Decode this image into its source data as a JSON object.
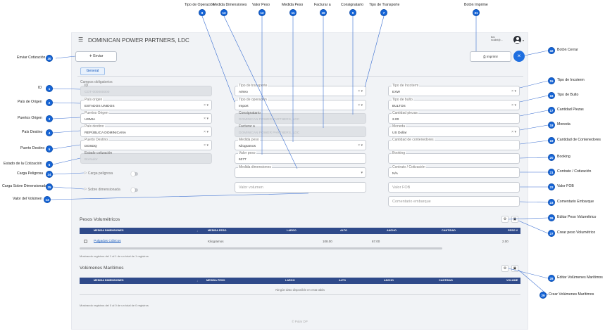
{
  "header": {
    "title": "DOMINICAN POWER PARTNERS, LDC",
    "user_name": "Bev",
    "user_email": "ecollet@..."
  },
  "toolbar": {
    "send_label": "Enviar",
    "print_label": "Imprimir"
  },
  "tabs": {
    "general": "General"
  },
  "form": {
    "required_note": "Campos obligatorios",
    "id": {
      "label": "ID",
      "value": "COT-000000000"
    },
    "pais_origen": {
      "label": "País origen",
      "value": "ESTADOS UNIDOS"
    },
    "puertos_origen": {
      "label": "Puertos Origen",
      "value": "USMIA"
    },
    "pais_destino": {
      "label": "País destino",
      "value": "REPÚBLICA DOMINICANA"
    },
    "puerto_destino": {
      "label": "Puerto Destino",
      "value": "DOSDQ"
    },
    "estado": {
      "label": "Estado cotización",
      "value": "Borrador"
    },
    "carga_peligrosa": {
      "label": "Carga peligrosa"
    },
    "sobre_dimensionada": {
      "label": "Sobre dimensionada"
    },
    "tipo_transporte": {
      "label": "Tipo de transporte",
      "value": "Aéreo"
    },
    "tipo_operacion": {
      "label": "Tipo de operación",
      "value": "Import"
    },
    "consignatario": {
      "label": "Consignatario",
      "value": "DOMINICAN POWER PARTNERS, LDC"
    },
    "facturar_a": {
      "label": "Facturar a",
      "value": "DOMINICAN POWER PARTNERS, LDC"
    },
    "medida_peso": {
      "label": "Medida peso",
      "value": "Kilogramos"
    },
    "valor_peso": {
      "label": "Valor peso",
      "value": "6277"
    },
    "medida_dimensiones": {
      "label": "Medida dimensiones"
    },
    "valor_volumen": {
      "placeholder": "Valor volumen"
    },
    "tipo_incoterm": {
      "label": "Tipo de Incoterm",
      "value": "EXW"
    },
    "tipo_bulto": {
      "label": "Tipo de bulto",
      "value": "BULTOS"
    },
    "cantidad_piezas": {
      "label": "Cantidad piezas",
      "value": "2.00"
    },
    "moneda": {
      "label": "Moneda",
      "value": "US Dollar"
    },
    "cantidad_contenedores": {
      "placeholder": "Cantidad de contenedores"
    },
    "booking": {
      "placeholder": "Booking"
    },
    "contrato": {
      "label": "Contrato / Cotización",
      "value": "N/A"
    },
    "valor_fob": {
      "placeholder": "Valor FOB"
    },
    "comentario": {
      "placeholder": "Comentario embarque"
    }
  },
  "pesos": {
    "title": "Pesos Volumétricos",
    "columns": [
      "MEDIDA DIMENSIONES",
      "MEDIDA PESO",
      "LARGO",
      "ALTO",
      "ANCHO",
      "CANTIDAD",
      "PESO V"
    ],
    "row": {
      "medida_dimensiones": "Pulgadas Cúbicos",
      "medida_peso": "Kilogramos",
      "largo": "108.00",
      "alto": "67.00",
      "ancho": "",
      "cantidad": "2.00"
    },
    "footer": "Mostrando registros del 1 al 1 de un total de 1 registros"
  },
  "volumenes": {
    "title": "Volúmenes Marítimos",
    "columns": [
      "MEDIDA DIMENSIONES",
      "MEDIDA PESO",
      "LARGO",
      "ALTO",
      "ANCHO",
      "CANTIDAD",
      "VOLUME"
    ],
    "empty": "Ningún dato disponible en esta tabla",
    "footer": "Mostrando registros del 0 al 0 de un total de 0 registros"
  },
  "footer": {
    "copyright": "© Polar DP"
  },
  "callouts": [
    {
      "n": "1",
      "text": "ID"
    },
    {
      "n": "2",
      "text": "País de Origen"
    },
    {
      "n": "3",
      "text": "Puertos Origen"
    },
    {
      "n": "4",
      "text": "País Destino"
    },
    {
      "n": "5",
      "text": "Puerto Destino"
    },
    {
      "n": "6",
      "text": "Estado de la Cotización"
    },
    {
      "n": "7",
      "text": "Tipo de Transporte"
    },
    {
      "n": "8",
      "text": "Tipo de Operación"
    },
    {
      "n": "9",
      "text": "Consignatario"
    },
    {
      "n": "10",
      "text": "Facturar a"
    },
    {
      "n": "11",
      "text": "Medida Peso"
    },
    {
      "n": "12",
      "text": "Valor Peso"
    },
    {
      "n": "13",
      "text": "Medida Dimensiones"
    },
    {
      "n": "14",
      "text": "Valor del Volúmen"
    },
    {
      "n": "15",
      "text": "Tipo de Incoterm"
    },
    {
      "n": "16",
      "text": "Tipo de Bulto"
    },
    {
      "n": "17",
      "text": "Cantidad Piezas"
    },
    {
      "n": "18",
      "text": "Moneda"
    },
    {
      "n": "19",
      "text": "Cantidad de Contenedores"
    },
    {
      "n": "20",
      "text": "Booking"
    },
    {
      "n": "21",
      "text": "Contrato / Cotización"
    },
    {
      "n": "22",
      "text": "Valor FOB"
    },
    {
      "n": "23",
      "text": "Comentario Embarque"
    },
    {
      "n": "24",
      "text": "Carga Peligrosa"
    },
    {
      "n": "25",
      "text": "Carga Sobre Dimensionada"
    },
    {
      "n": "26",
      "text": "Editar Peso Volumétrico"
    },
    {
      "n": "27",
      "text": "Crear peso Volumétrico"
    },
    {
      "n": "28",
      "text": "Editar Volúmenes Marítimos"
    },
    {
      "n": "29",
      "text": "Crear Volúmenes Marítimos"
    },
    {
      "n": "30",
      "text": "Enviar Cotización"
    },
    {
      "n": "31",
      "text": "Botón Imprime"
    },
    {
      "n": "32",
      "text": "Botón Cerrar"
    }
  ],
  "colors": {
    "primary": "#1565d8",
    "table_header": "#2f4a8a",
    "disabled": "#dfe2e6"
  }
}
